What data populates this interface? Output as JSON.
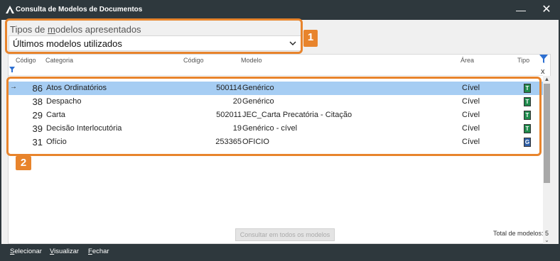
{
  "window": {
    "title": "Consulta de Modelos de Documentos",
    "minimize_glyph": "—",
    "close_glyph": "✕"
  },
  "tipos": {
    "label_pre": "Tipos de ",
    "label_u": "m",
    "label_post": "odelos apresentados",
    "selected": "Últimos modelos utilizados"
  },
  "annotations": {
    "badge1": "1",
    "badge2": "2",
    "accent": "#e8842c"
  },
  "grid": {
    "headers": {
      "codigo": "Código",
      "categoria": "Categoria",
      "codigo2": "Código",
      "modelo": "Modelo",
      "area": "Área",
      "tipo": "Tipo"
    },
    "rows": [
      {
        "codigo": "86",
        "categoria": "Atos Ordinatórios",
        "codigo2": "500114",
        "modelo": "Genérico",
        "area": "Cível",
        "tipo": "T",
        "tipo_color": "#1f8a4c",
        "selected": true
      },
      {
        "codigo": "38",
        "categoria": "Despacho",
        "codigo2": "20",
        "modelo": "Genérico",
        "area": "Cível",
        "tipo": "T",
        "tipo_color": "#1f8a4c",
        "selected": false
      },
      {
        "codigo": "29",
        "categoria": "Carta",
        "codigo2": "502011",
        "modelo": "JEC_Carta Precatória - Citação",
        "area": "Cível",
        "tipo": "T",
        "tipo_color": "#1f8a4c",
        "selected": false
      },
      {
        "codigo": "39",
        "categoria": "Decisão Interlocutória",
        "codigo2": "19",
        "modelo": "Genérico - cível",
        "area": "Cível",
        "tipo": "T",
        "tipo_color": "#1f8a4c",
        "selected": false
      },
      {
        "codigo": "31",
        "categoria": "Ofício",
        "codigo2": "253365",
        "modelo": "OFICIO",
        "area": "Cível",
        "tipo": "G",
        "tipo_color": "#2d5fa8",
        "selected": false
      }
    ],
    "row_arrow": "→",
    "clear_filter": "x"
  },
  "footer": {
    "consult_all": "Consultar em todos os modelos",
    "total": "Total de modelos: 5"
  },
  "bottom": {
    "selecionar_u": "S",
    "selecionar_rest": "elecionar",
    "visualizar_u": "V",
    "visualizar_rest": "isualizar",
    "fechar_u": "F",
    "fechar_rest": "echar"
  }
}
